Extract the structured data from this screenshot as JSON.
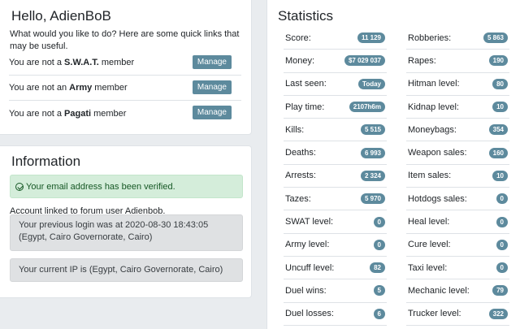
{
  "hello": {
    "title": "Hello, AdienBoB",
    "intro": "What would you like to do? Here are some quick links that may be useful.",
    "members": [
      {
        "prefix": "You are not a",
        "group": "S.W.A.T.",
        "suffix": "member",
        "button": "Manage"
      },
      {
        "prefix": "You are not an",
        "group": "Army",
        "suffix": "member",
        "button": "Manage"
      },
      {
        "prefix": "You are not a",
        "group": "Pagati",
        "suffix": "member",
        "button": "Manage"
      }
    ]
  },
  "information": {
    "title": "Information",
    "verified": "Your email address has been verified.",
    "linked": "Account linked to forum user Adienbob.",
    "previous_login": "Your previous login was at 2020-08-30 18:43:05 (Egypt, Cairo Governorate, Cairo)",
    "current_ip": "Your current IP is (Egypt, Cairo Governorate, Cairo)"
  },
  "statistics": {
    "title": "Statistics",
    "left": [
      {
        "label": "Score:",
        "value": "11 129"
      },
      {
        "label": "Money:",
        "value": "$7 029 037"
      },
      {
        "label": "Last seen:",
        "value": "Today"
      },
      {
        "label": "Play time:",
        "value": "2107h6m"
      },
      {
        "label": "Kills:",
        "value": "5 515"
      },
      {
        "label": "Deaths:",
        "value": "6 993"
      },
      {
        "label": "Arrests:",
        "value": "2 324"
      },
      {
        "label": "Tazes:",
        "value": "5 970"
      },
      {
        "label": "SWAT level:",
        "value": "0"
      },
      {
        "label": "Army level:",
        "value": "0"
      },
      {
        "label": "Uncuff level:",
        "value": "82"
      },
      {
        "label": "Duel wins:",
        "value": "5"
      },
      {
        "label": "Duel losses:",
        "value": "6"
      }
    ],
    "right": [
      {
        "label": "Robberies:",
        "value": "5 863"
      },
      {
        "label": "Rapes:",
        "value": "190"
      },
      {
        "label": "Hitman level:",
        "value": "80"
      },
      {
        "label": "Kidnap level:",
        "value": "10"
      },
      {
        "label": "Moneybags:",
        "value": "354"
      },
      {
        "label": "Weapon sales:",
        "value": "160"
      },
      {
        "label": "Item sales:",
        "value": "10"
      },
      {
        "label": "Hotdogs sales:",
        "value": "0"
      },
      {
        "label": "Heal level:",
        "value": "0"
      },
      {
        "label": "Cure level:",
        "value": "0"
      },
      {
        "label": "Taxi level:",
        "value": "0"
      },
      {
        "label": "Mechanic level:",
        "value": "79"
      },
      {
        "label": "Trucker level:",
        "value": "322"
      }
    ]
  }
}
